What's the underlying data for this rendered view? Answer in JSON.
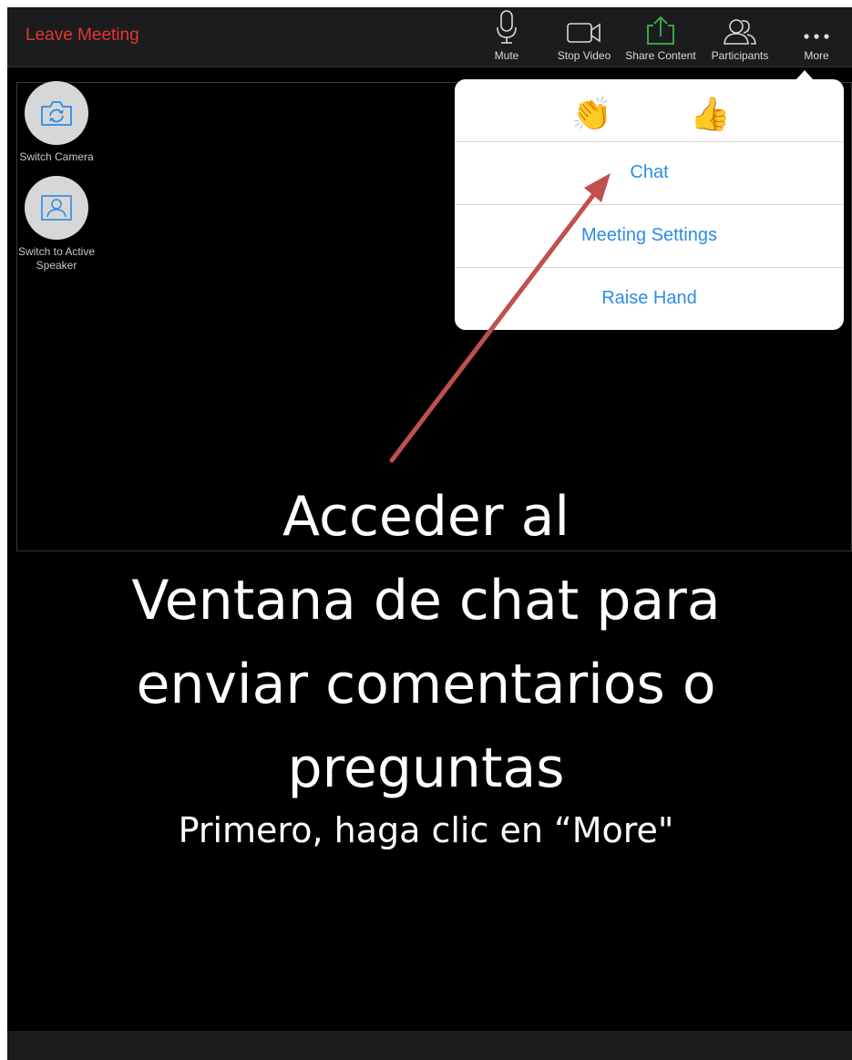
{
  "toolbar": {
    "leave_label": "Leave Meeting",
    "buttons": [
      {
        "label": "Mute",
        "icon": "microphone-icon"
      },
      {
        "label": "Stop Video",
        "icon": "video-camera-icon"
      },
      {
        "label": "Share Content",
        "icon": "share-upload-icon"
      },
      {
        "label": "Participants",
        "icon": "participants-icon"
      },
      {
        "label": "More",
        "icon": "more-dots-icon"
      }
    ]
  },
  "side_controls": [
    {
      "label": "Switch Camera",
      "icon": "switch-camera-icon"
    },
    {
      "label": "Switch to Active Speaker",
      "icon": "active-speaker-icon"
    }
  ],
  "more_menu": {
    "reactions": [
      {
        "emoji": "👏",
        "icon": "clapping-hands-icon"
      },
      {
        "emoji": "👍",
        "icon": "thumbs-up-icon"
      }
    ],
    "items": [
      "Chat",
      "Meeting Settings",
      "Raise Hand"
    ]
  },
  "caption": {
    "lines": [
      "Acceder al",
      "Ventana de chat para",
      "enviar comentarios o",
      "preguntas"
    ],
    "subtitle": "Primero, haga clic en “More\""
  },
  "colors": {
    "leave_red": "#e8342d",
    "menu_blue": "#2d8ce6",
    "share_green": "#3bb54a",
    "arrow_red": "#c0504d"
  }
}
